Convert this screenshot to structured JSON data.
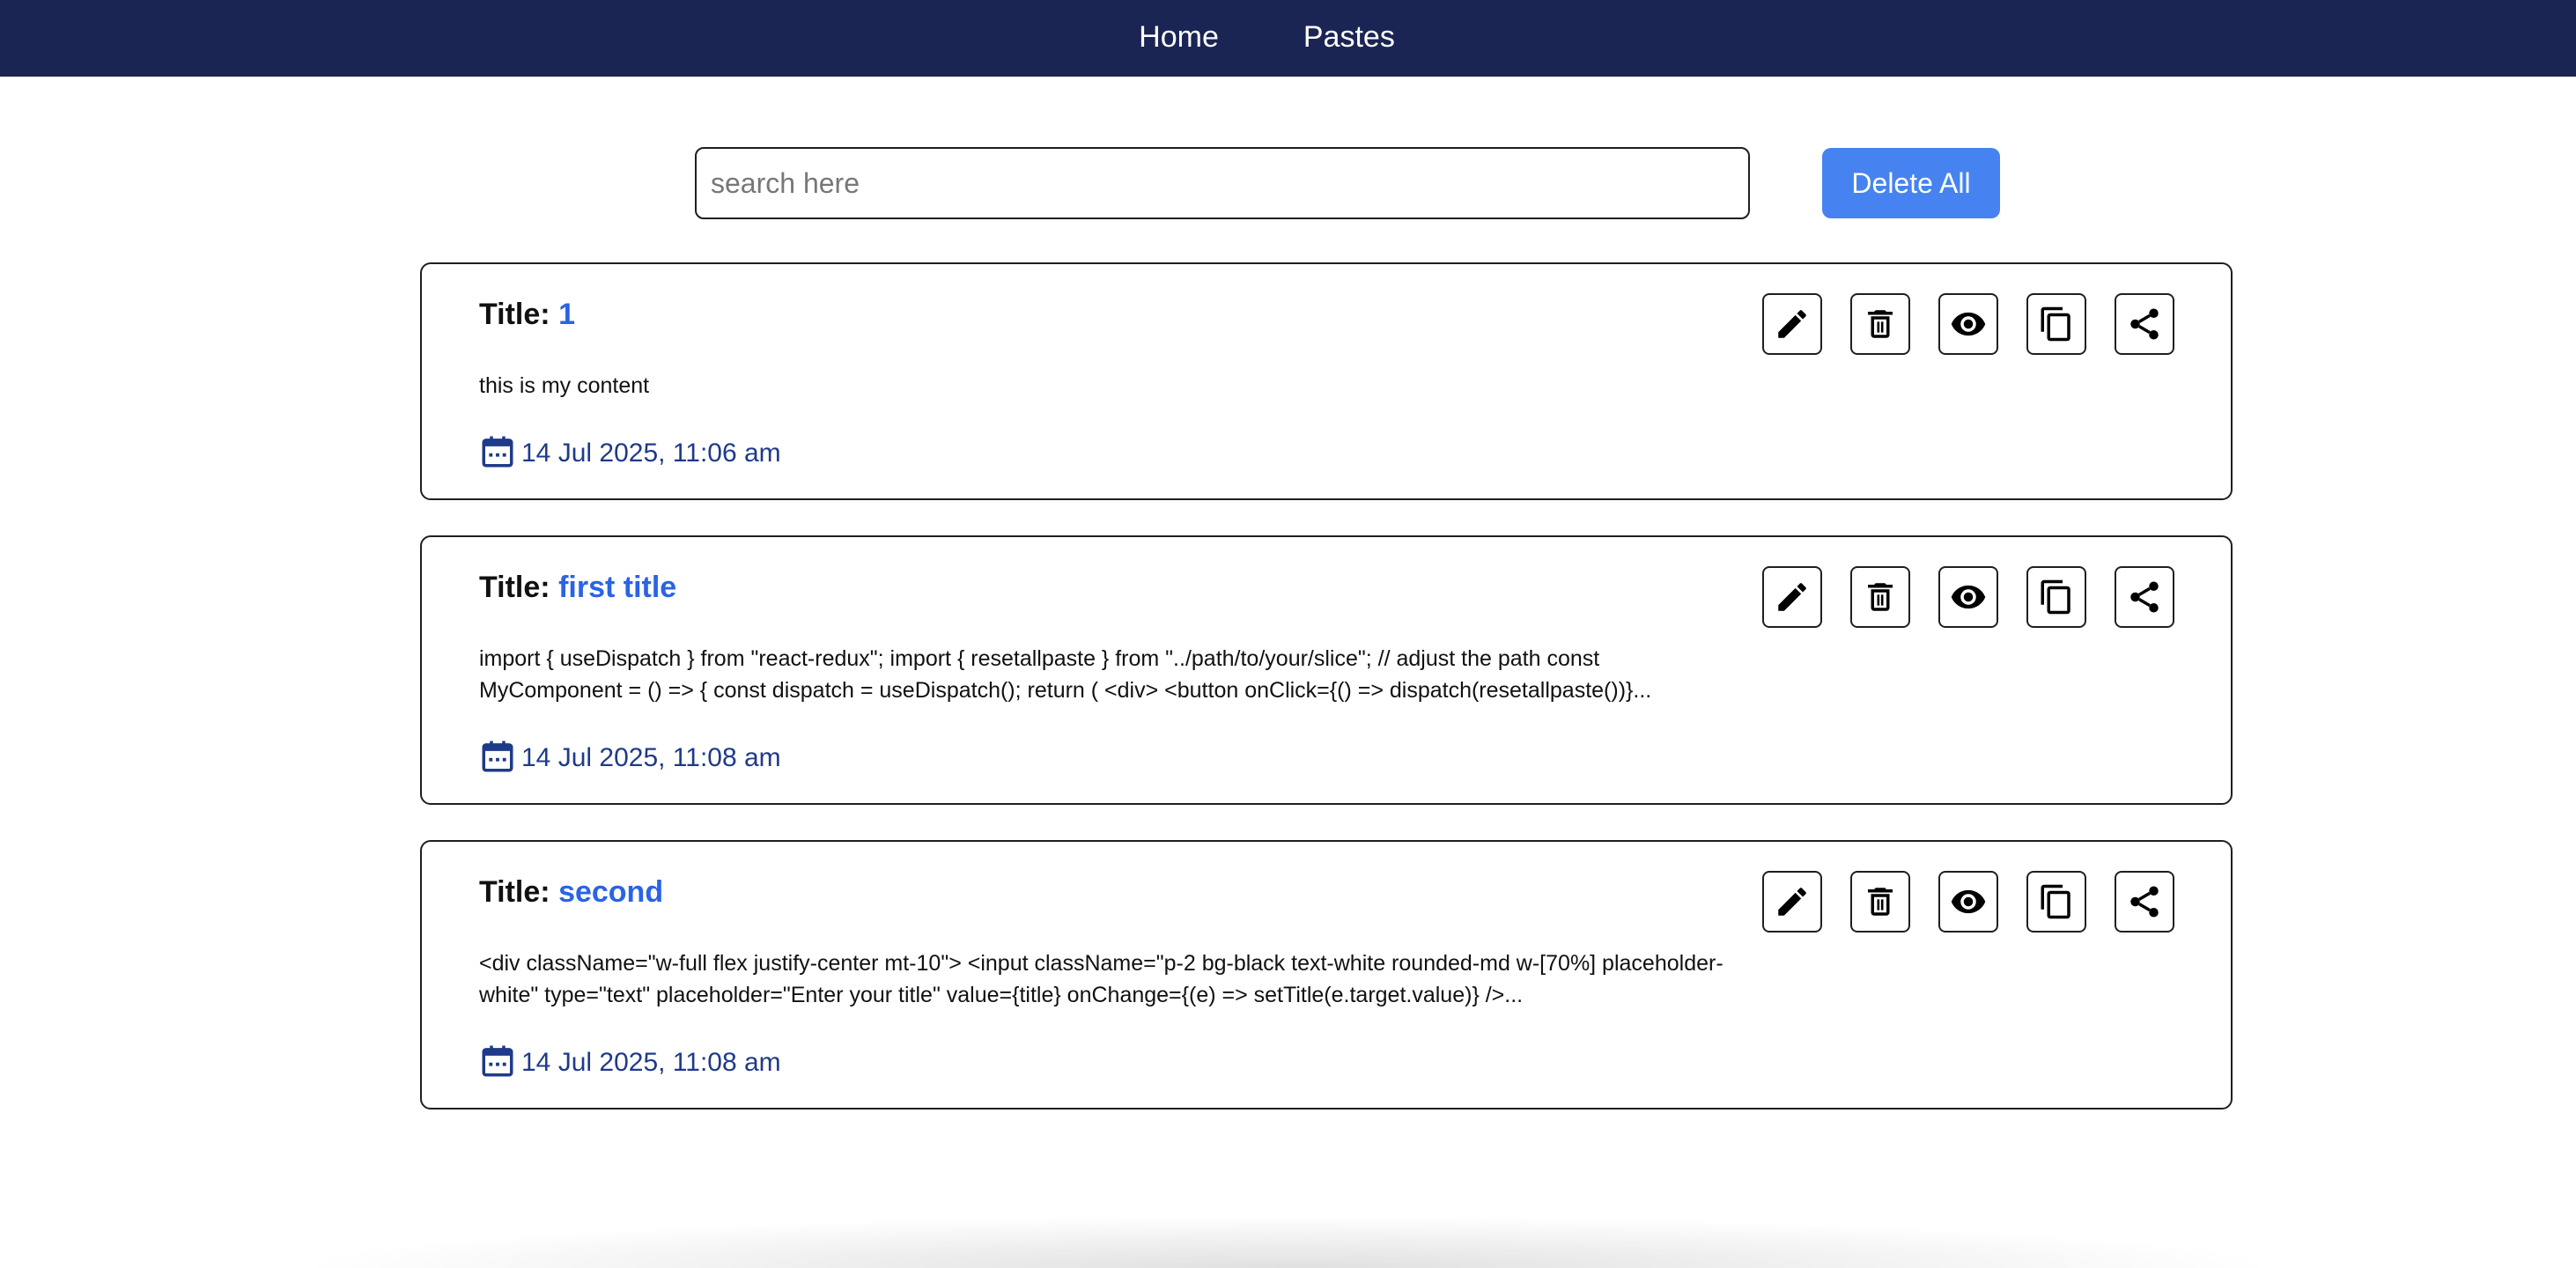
{
  "nav": {
    "home": "Home",
    "pastes": "Pastes"
  },
  "search": {
    "placeholder": "search here",
    "value": ""
  },
  "delete_all_label": "Delete All",
  "colors": {
    "navbar": "#1b2553",
    "accent_button": "#4683f0",
    "title_value": "#2a63e6",
    "date_text": "#1f3a8a"
  },
  "pastes": [
    {
      "title_label": "Title:",
      "title": "1",
      "content": "this is my content",
      "date": "14 Jul 2025, 11:06 am",
      "icons": [
        "calendar-icon",
        "edit-icon",
        "delete-icon",
        "view-icon",
        "copy-icon",
        "share-icon"
      ]
    },
    {
      "title_label": "Title:",
      "title": "first title",
      "content": "import { useDispatch } from \"react-redux\"; import { resetallpaste } from \"../path/to/your/slice\"; // adjust the path const MyComponent = () => { const dispatch = useDispatch(); return ( <div> <button onClick={() => dispatch(resetallpaste())}...",
      "date": "14 Jul 2025, 11:08 am",
      "icons": [
        "calendar-icon",
        "edit-icon",
        "delete-icon",
        "view-icon",
        "copy-icon",
        "share-icon"
      ]
    },
    {
      "title_label": "Title:",
      "title": "second",
      "content": "<div className=\"w-full flex justify-center mt-10\"> <input className=\"p-2 bg-black text-white rounded-md w-[70%] placeholder-white\" type=\"text\" placeholder=\"Enter your title\" value={title} onChange={(e) => setTitle(e.target.value)} />...",
      "date": "14 Jul 2025, 11:08 am",
      "icons": [
        "calendar-icon",
        "edit-icon",
        "delete-icon",
        "view-icon",
        "copy-icon",
        "share-icon"
      ]
    }
  ]
}
